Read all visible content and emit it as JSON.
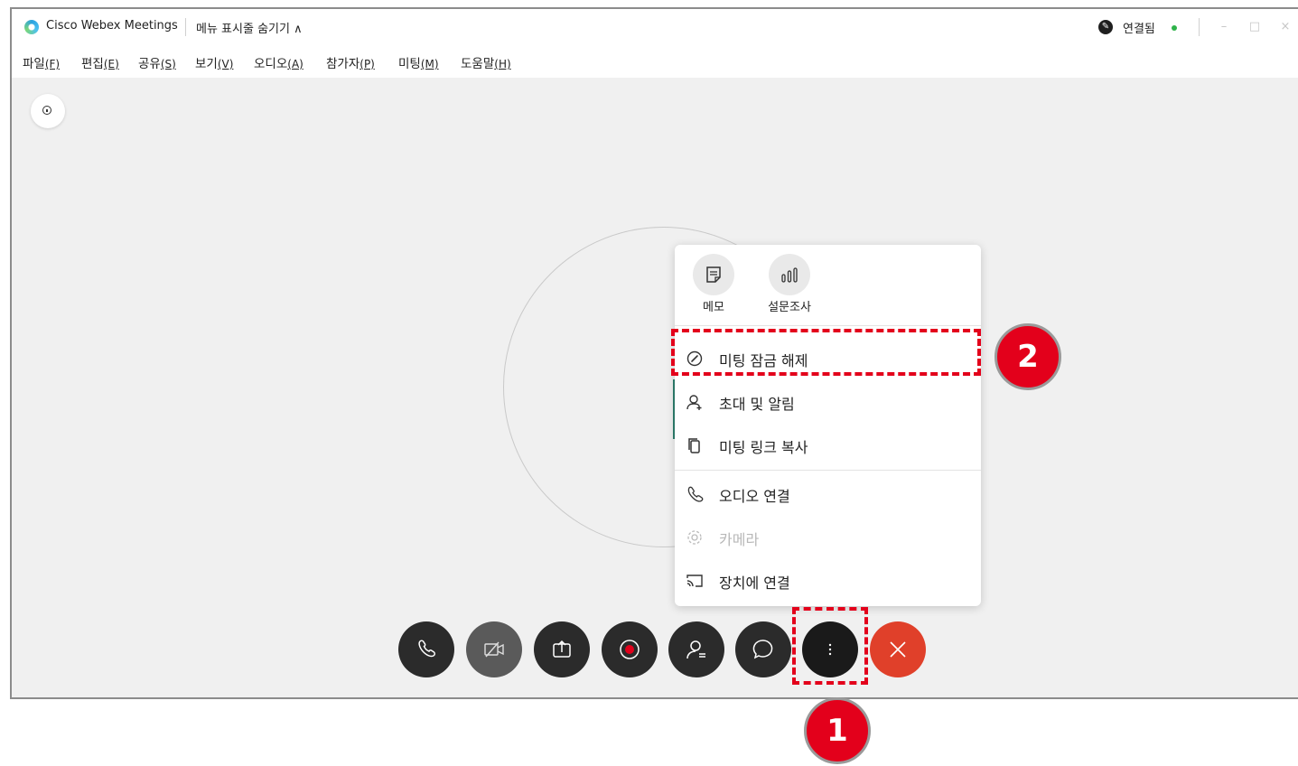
{
  "window": {
    "app_title": "Cisco Webex Meetings",
    "menu_toggle": "메뉴 표시줄 숨기기 ∧",
    "connection_status": "연결됨",
    "window_controls": [
      "–",
      "□",
      "×"
    ]
  },
  "menubar": [
    {
      "label": "파일",
      "accel": "(F)"
    },
    {
      "label": "편집",
      "accel": "(E)"
    },
    {
      "label": "공유",
      "accel": "(S)"
    },
    {
      "label": "보기",
      "accel": "(V)"
    },
    {
      "label": "오디오",
      "accel": "(A)"
    },
    {
      "label": "참가자",
      "accel": "(P)"
    },
    {
      "label": "미팅",
      "accel": "(M)"
    },
    {
      "label": "도움말",
      "accel": "(H)"
    }
  ],
  "more_menu": {
    "grid": [
      {
        "label": "메모",
        "icon": "notes-icon"
      },
      {
        "label": "설문조사",
        "icon": "polling-icon"
      }
    ],
    "items": [
      {
        "label": "미팅 잠금 해제",
        "icon": "unlock-icon",
        "enabled": true
      },
      {
        "label": "초대 및 알림",
        "icon": "invite-user-icon",
        "enabled": true
      },
      {
        "label": "미팅 링크 복사",
        "icon": "copy-icon",
        "enabled": true
      },
      {
        "label": "오디오 연결",
        "icon": "phone-icon",
        "enabled": true
      },
      {
        "label": "카메라",
        "icon": "gear-icon",
        "enabled": false
      },
      {
        "label": "장치에 연결",
        "icon": "cast-icon",
        "enabled": true
      }
    ]
  },
  "controls": [
    {
      "name": "audio-button",
      "icon": "phone-icon"
    },
    {
      "name": "video-button",
      "icon": "video-off-icon"
    },
    {
      "name": "share-button",
      "icon": "share-icon"
    },
    {
      "name": "record-button",
      "icon": "record-icon"
    },
    {
      "name": "participants-button",
      "icon": "participants-icon"
    },
    {
      "name": "chat-button",
      "icon": "chat-icon"
    },
    {
      "name": "more-options-button",
      "icon": "more-vertical-icon"
    },
    {
      "name": "leave-button",
      "icon": "close-icon"
    }
  ],
  "annotations": {
    "step1": "1",
    "step2": "2"
  },
  "colors": {
    "accent_red": "#e3001b",
    "leave_red": "#e0402a",
    "status_green": "#2fb34a"
  }
}
